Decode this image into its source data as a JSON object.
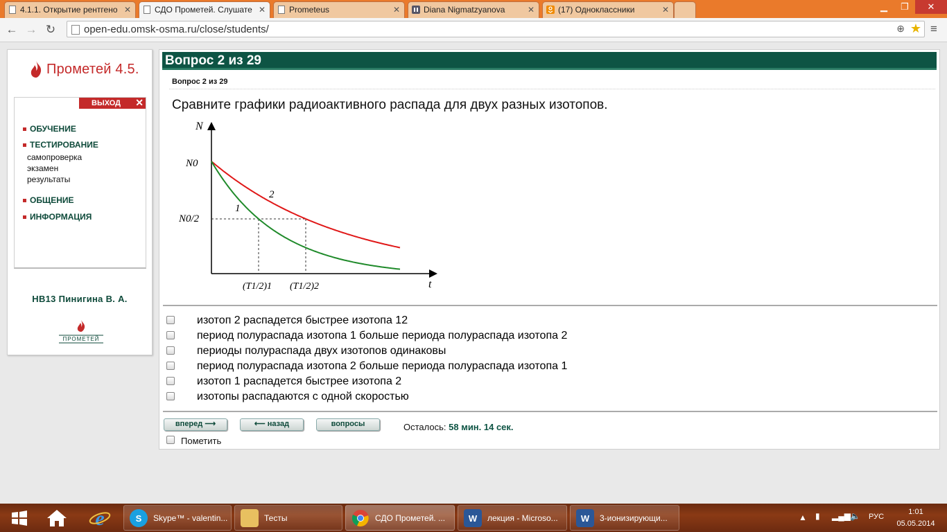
{
  "browser": {
    "tabs": [
      {
        "title": "4.1.1. Открытие рентгено",
        "icon": "page-icon",
        "active": false
      },
      {
        "title": "СДО Прометей. Слушате",
        "icon": "page-icon",
        "active": true
      },
      {
        "title": "Prometeus",
        "icon": "page-icon",
        "active": false
      },
      {
        "title": "Diana Nigmatzyanova",
        "icon": "pause-icon",
        "active": false
      },
      {
        "title": "(17) Одноклассники",
        "icon": "odnoklassniki-icon",
        "active": false
      }
    ],
    "url": "open-edu.omsk-osma.ru/close/students/"
  },
  "sidebar": {
    "logo_text": "Прометей 4.5.",
    "exit_label": "ВЫХОД",
    "menu": [
      {
        "label": "ОБУЧЕНИЕ"
      },
      {
        "label": "ТЕСТИРОВАНИЕ",
        "subitems": [
          "самопроверка",
          "экзамен",
          "результаты"
        ]
      },
      {
        "label": "ОБЩЕНИЕ"
      },
      {
        "label": "ИНФОРМАЦИЯ"
      }
    ],
    "user": "НВ13 Пинигина В. А.",
    "small_logo_text": "ПРОМЕТЕЙ"
  },
  "question": {
    "header": "Вопрос 2 из 29",
    "subheader": "Вопрос 2 из 29",
    "text": "Сравните графики радиоактивного распада для двух разных изотопов.",
    "options": [
      "изотоп 2 распадется быстрее изотопа 12",
      "период полураспада изотопа 1 больше периода полураспада изотопа 2",
      "периоды полураспада двух изотопов одинаковы",
      "период полураспада изотопа 2 больше периода полураспада изотопа 1",
      "изотоп 1 распадется быстрее изотопа 2",
      "изотопы распадаются с одной скоростью"
    ],
    "nav": {
      "forward": "вперед",
      "back": "назад",
      "questions": "вопросы"
    },
    "remaining_label": "Осталось:",
    "remaining_value": "58 мин. 14 сек.",
    "mark_label": "Пометить"
  },
  "chart_data": {
    "type": "line",
    "ylabel": "N",
    "xlabel": "t",
    "y_ticks": [
      "N0",
      "N0/2"
    ],
    "x_ticks": [
      "(T1/2)1",
      "(T1/2)2"
    ],
    "series": [
      {
        "name": "1",
        "color": "#1f8a2a",
        "half_life": 1.0
      },
      {
        "name": "2",
        "color": "#e01818",
        "half_life": 2.0
      }
    ],
    "colors": {
      "curve1": "#1f8a2a",
      "curve2": "#e01818"
    }
  },
  "taskbar": {
    "items": [
      {
        "label": "Skype™ - valentin...",
        "icon": "skype-icon",
        "active": false
      },
      {
        "label": "Тесты",
        "icon": "folder-icon",
        "active": false
      },
      {
        "label": "СДО Прометей. ...",
        "icon": "chrome-icon",
        "active": true
      },
      {
        "label": "лекция - Microso...",
        "icon": "word-icon",
        "active": false
      },
      {
        "label": "3-ионизирующи...",
        "icon": "word-icon",
        "active": false
      }
    ],
    "lang": "РУС",
    "time": "1:01",
    "date": "05.05.2014"
  }
}
